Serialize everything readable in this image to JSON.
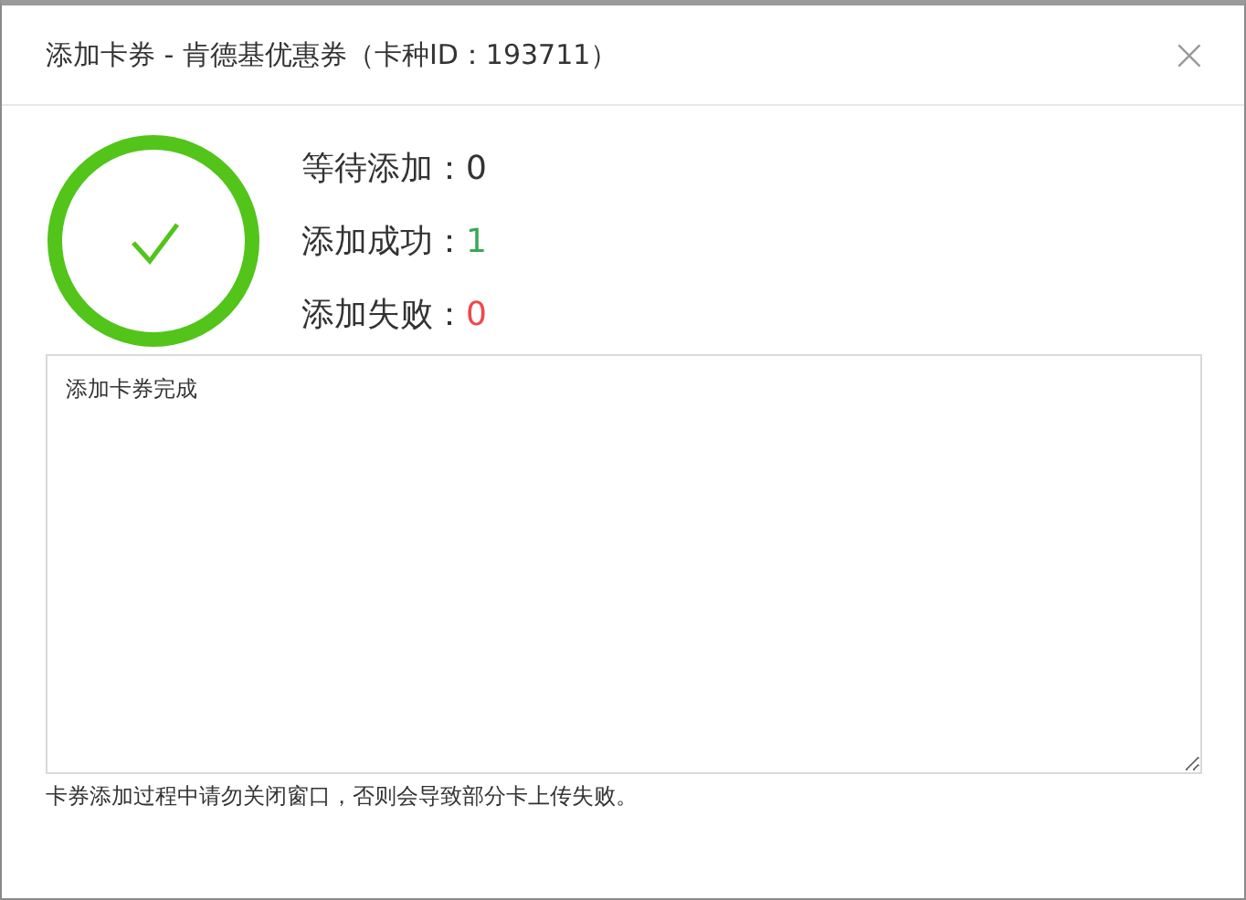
{
  "dialog": {
    "title": "添加卡券 - 肯德基优惠券（卡种ID：193711）",
    "close": "×"
  },
  "status": {
    "done": true
  },
  "stats": [
    {
      "label": "等待添加：",
      "value": "0",
      "color": "#333333"
    },
    {
      "label": "添加成功：",
      "value": "1",
      "color": "#3aa757"
    },
    {
      "label": "添加失败：",
      "value": "0",
      "color": "#f04848"
    }
  ],
  "log": {
    "value": "添加卡券完成"
  },
  "notice": "卡券添加过程中请勿关闭窗口，否则会导致部分卡上传失败。"
}
